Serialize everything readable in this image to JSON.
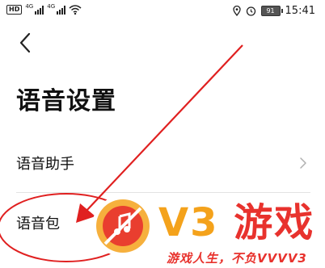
{
  "status_bar": {
    "sim_badge": "HD",
    "net_label_1": "4G",
    "net_label_2": "4G",
    "battery_level": "91",
    "time": "15:41",
    "icons": [
      "hd-icon",
      "signal-icon",
      "wifi-icon",
      "location-icon",
      "alarm-icon",
      "battery-icon"
    ]
  },
  "page": {
    "back_icon": "back-arrow-icon",
    "title": "语音设置",
    "rows": [
      {
        "label": "语音助手",
        "has_chevron": true
      },
      {
        "label": "语音包",
        "has_chevron": false
      }
    ]
  },
  "annotation": {
    "arrow_color": "#e02020",
    "ellipse_color": "#e02020"
  },
  "watermark": {
    "brand_latin": "V3",
    "brand_cn": "游戏",
    "slogan": "游戏人生，不负VVVV3",
    "colors": {
      "orange": "#f4a21b",
      "red": "#e8322d"
    }
  }
}
